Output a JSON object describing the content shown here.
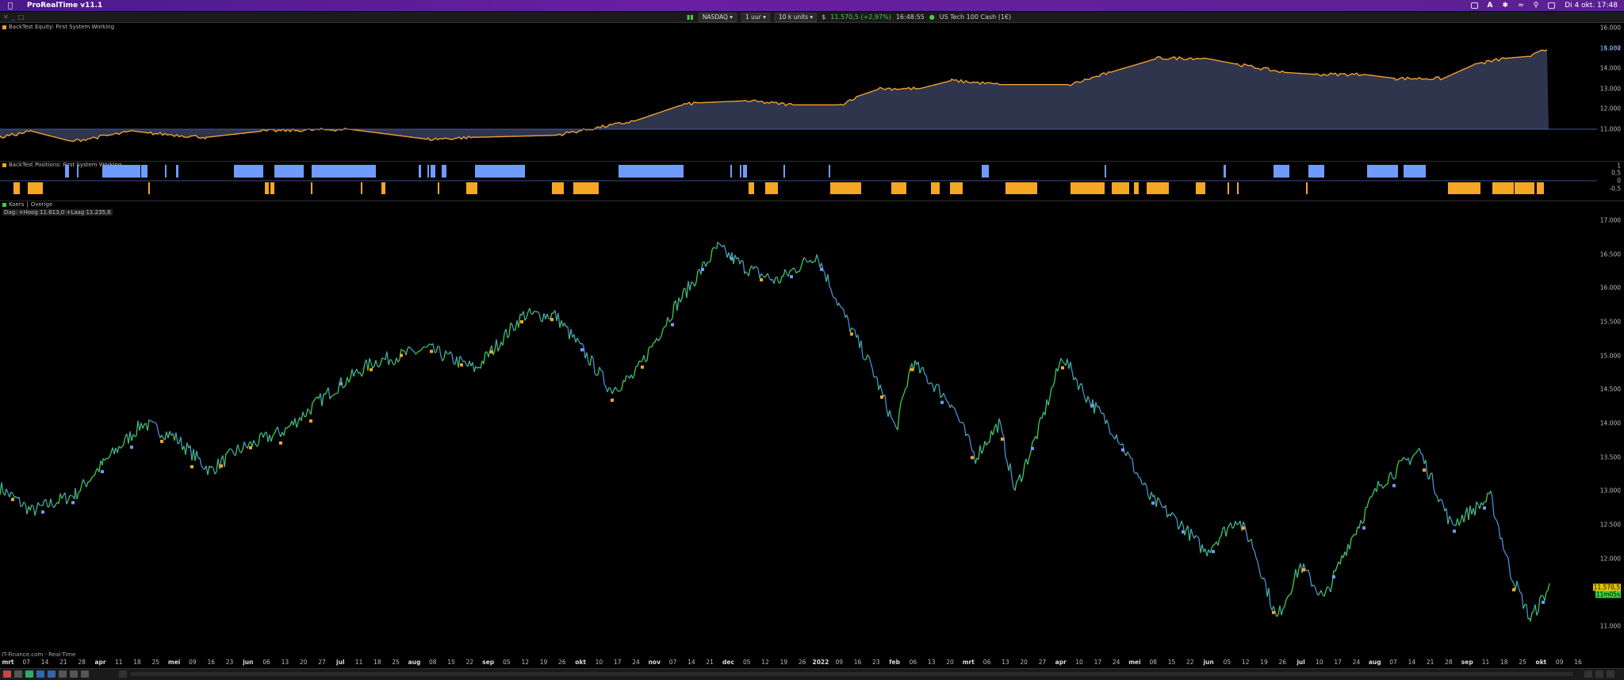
{
  "menubar": {
    "app_name": "ProRealTime v11.1",
    "datetime": "Di 4 okt. 17:48"
  },
  "toolbar": {
    "exchange": "NASDAQ",
    "timeframe": "1 uur",
    "units": "10 k units",
    "price": "11.570,5 (+2,97%)",
    "time": "16:48:55",
    "instrument": "US Tech 100 Cash (1€)"
  },
  "equity": {
    "label": "BackTest Equity: First System Working",
    "last_value": "14.967",
    "ticks": [
      "16.000",
      "15.000",
      "14.000",
      "13.000",
      "12.000",
      "11.000"
    ],
    "line_color": "#f0a030",
    "fill_color": "#3a4260"
  },
  "positions": {
    "label": "BackTest Positions: First System Working",
    "ticks": [
      "1",
      "0,5",
      "0",
      "-0,5"
    ],
    "long_color": "#6f9bff",
    "short_color": "#f5a623"
  },
  "price": {
    "label": "Koers",
    "label2": "Overige",
    "info": "Dag: +Hoog 11.613,0 +Laag 11.235,6",
    "ticks": [
      "17.000",
      "16.500",
      "16.000",
      "15.500",
      "15.000",
      "14.500",
      "14.000",
      "13.500",
      "13.000",
      "12.500",
      "12.000",
      "11.500",
      "11.000"
    ],
    "last_price": "11.570,5",
    "last_time": "11m05s",
    "up_color": "#3ed13e",
    "down_color": "#4a8fd8"
  },
  "time_axis": [
    "mrt",
    "07",
    "14",
    "21",
    "28",
    "apr",
    "11",
    "18",
    "25",
    "mei",
    "09",
    "16",
    "23",
    "jun",
    "06",
    "13",
    "20",
    "27",
    "jul",
    "11",
    "18",
    "25",
    "aug",
    "08",
    "15",
    "22",
    "sep",
    "05",
    "12",
    "19",
    "26",
    "okt",
    "10",
    "17",
    "24",
    "nov",
    "07",
    "14",
    "21",
    "dec",
    "05",
    "12",
    "19",
    "26",
    "2022",
    "09",
    "16",
    "23",
    "feb",
    "06",
    "13",
    "20",
    "mrt",
    "06",
    "13",
    "20",
    "27",
    "apr",
    "10",
    "17",
    "24",
    "mei",
    "08",
    "15",
    "22",
    "jun",
    "05",
    "12",
    "19",
    "26",
    "jul",
    "10",
    "17",
    "24",
    "aug",
    "07",
    "14",
    "21",
    "28",
    "sep",
    "11",
    "18",
    "25",
    "okt",
    "09",
    "16"
  ],
  "footer": {
    "source": "IT-Finance.com - Real-Time"
  }
}
